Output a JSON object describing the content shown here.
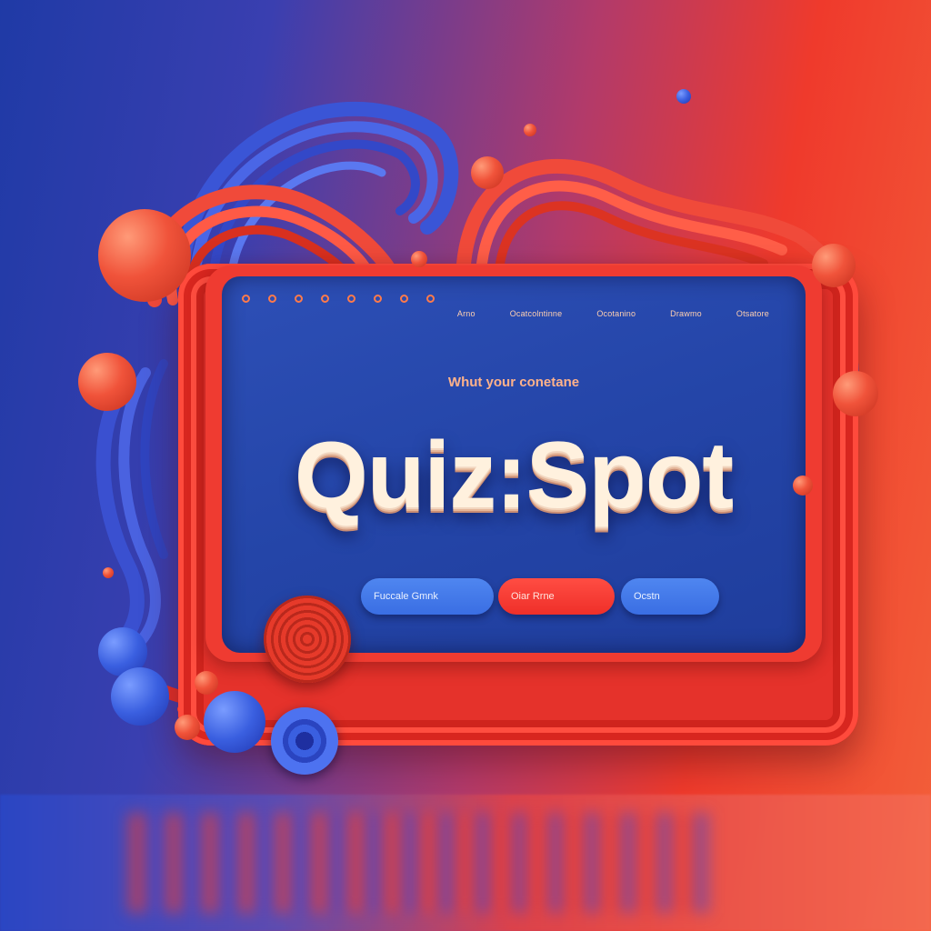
{
  "window": {
    "controls": [
      "window-dot",
      "window-dot",
      "window-dot",
      "window-dot",
      "window-dot",
      "window-dot",
      "window-dot",
      "window-dot"
    ]
  },
  "nav": {
    "items": [
      {
        "label": "Arno"
      },
      {
        "label": "Ocatcolntinne"
      },
      {
        "label": "Ocotanino"
      },
      {
        "label": "Drawmo"
      },
      {
        "label": "Otsatore"
      }
    ]
  },
  "hero": {
    "tagline": "Whut your conetane",
    "title": "Quiz:Spot"
  },
  "buttons": {
    "primary_label": "Fuccale Gmnk",
    "accent_label": "Oiar Rrne",
    "secondary_label": "Ocstn"
  },
  "colors": {
    "accent_red": "#ef3b31",
    "screen_blue": "#2445a8",
    "button_blue": "#3a6ee3",
    "title_cream": "#fff1de"
  }
}
